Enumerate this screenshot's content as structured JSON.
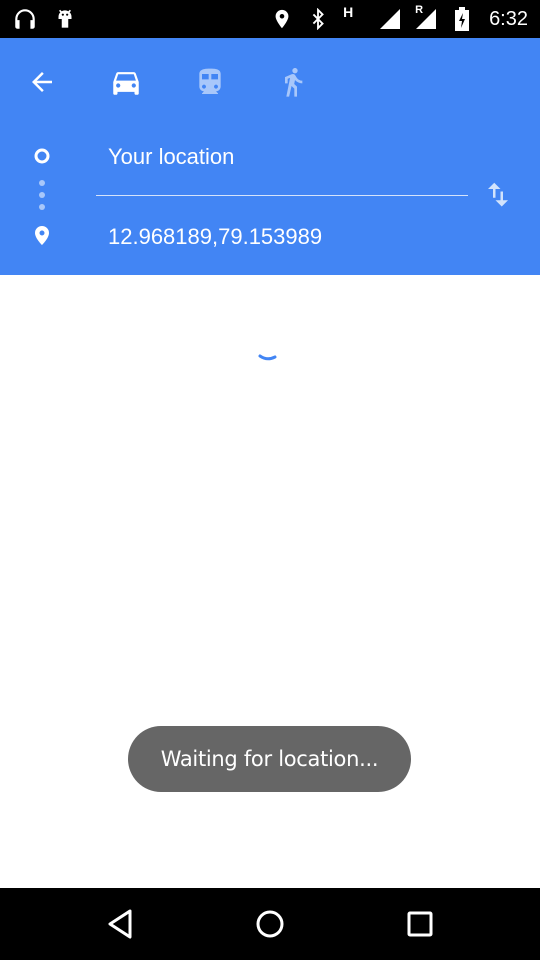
{
  "status_bar": {
    "time": "6:32",
    "icons": [
      "headphones-icon",
      "android-debug-icon",
      "location-icon",
      "bluetooth-icon",
      "network-h-icon",
      "signal-icon",
      "roaming-signal-icon",
      "battery-charging-icon"
    ],
    "network_label": "H",
    "roaming_label": "R"
  },
  "header": {
    "background": "#4285f4",
    "modes": [
      {
        "name": "car",
        "selected": true
      },
      {
        "name": "transit",
        "selected": false
      },
      {
        "name": "walk",
        "selected": false
      }
    ],
    "from_text": "Your location",
    "to_text": "12.968189,79.153989"
  },
  "toast": {
    "text": "Waiting for location..."
  },
  "colors": {
    "accent": "#4285f4",
    "toast_bg": "#666666",
    "spinner": "#4285f4"
  }
}
